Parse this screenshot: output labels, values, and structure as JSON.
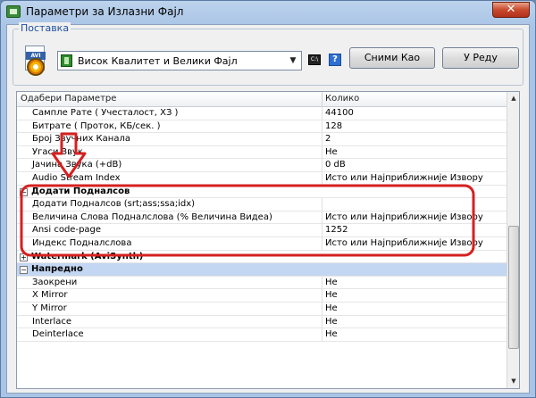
{
  "window": {
    "title": "Параметри за Излазни Фајл",
    "close_glyph": "✕"
  },
  "settings": {
    "group_label": "Поставка",
    "profile_value": "Висок Квалитет и Велики Фајл",
    "save_as_label": "Сними Као",
    "ok_label": "У Реду",
    "help_glyph": "?"
  },
  "grid": {
    "headers": {
      "name": "Одабери Параметре",
      "value": "Колико"
    },
    "rows": [
      {
        "name": "Сампле Рате ( Учесталост, ХЗ )",
        "value": "44100"
      },
      {
        "name": "Битрате ( Проток, КБ/сек. )",
        "value": "128"
      },
      {
        "name": "Број Звучних Канала",
        "value": "2"
      },
      {
        "name": "Угаси Звук",
        "value": "Не"
      },
      {
        "name": "Јачина Звука (+dB)",
        "value": "0 dB"
      },
      {
        "name": "Audio Stream Index",
        "value": "Исто или Најприближније Извору"
      },
      {
        "name": "Додати Подналсов",
        "toggle": "−",
        "category": true
      },
      {
        "name": "Додати Подналсов (srt;ass;ssa;idx)",
        "value": ""
      },
      {
        "name": "Величина Слова Подналслова (% Величина Видеа)",
        "value": "Исто или Најприближније Извору"
      },
      {
        "name": "Ansi code-page",
        "value": "1252"
      },
      {
        "name": "Индекс Подналслова",
        "value": "Исто или Најприближније Извору"
      },
      {
        "name": "Watermark (AviSynth)",
        "toggle": "+",
        "category": true
      },
      {
        "name": "Напредно",
        "toggle": "−",
        "category": true,
        "selected": true
      },
      {
        "name": "Заокрени",
        "value": "Не"
      },
      {
        "name": "X Mirror",
        "value": "Не"
      },
      {
        "name": "Y Mirror",
        "value": "Не"
      },
      {
        "name": "Interlace",
        "value": "Не"
      },
      {
        "name": "Deinterlace",
        "value": "Не"
      }
    ]
  },
  "colors": {
    "annotation": "#d62020",
    "selection": "#c3d6f2"
  }
}
